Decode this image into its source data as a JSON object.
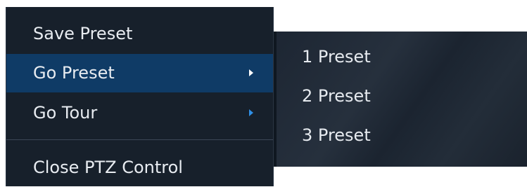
{
  "main_menu": {
    "items": [
      {
        "label": "Save Preset",
        "has_submenu": false,
        "highlighted": false
      },
      {
        "label": "Go Preset",
        "has_submenu": true,
        "highlighted": true
      },
      {
        "label": "Go Tour",
        "has_submenu": true,
        "highlighted": false
      },
      {
        "label": "Close PTZ Control",
        "has_submenu": false,
        "highlighted": false
      }
    ]
  },
  "submenu": {
    "items": [
      {
        "label": "1 Preset"
      },
      {
        "label": "2 Preset"
      },
      {
        "label": "3 Preset"
      }
    ]
  },
  "colors": {
    "menu_background": "#17202b",
    "highlight": "#0f3b66",
    "arrow_active": "#ffffff",
    "arrow_inactive": "#2f8fe6",
    "text": "#e8ecf1"
  }
}
